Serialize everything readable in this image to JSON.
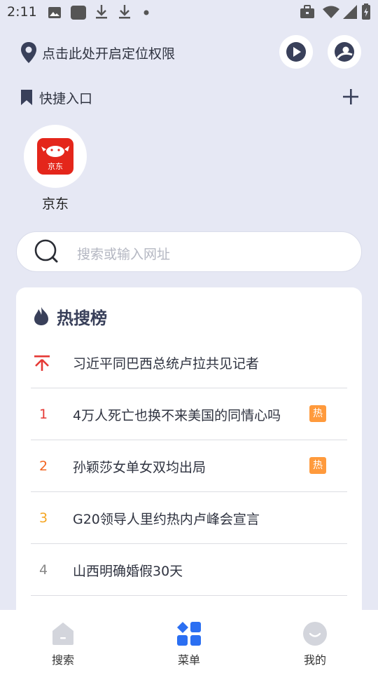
{
  "status_bar": {
    "time": "2:11",
    "icons": [
      "image-icon",
      "square-icon",
      "download-icon",
      "download-icon",
      "dot-icon",
      "briefcase-icon",
      "wifi-icon",
      "signal-icon",
      "battery-icon"
    ]
  },
  "location": {
    "text": "点击此处开启定位权限",
    "icon": "location-pin-icon"
  },
  "header_buttons": {
    "play": "play-icon",
    "user": "user-icon"
  },
  "quick_entry": {
    "title": "快捷入口",
    "icon": "bookmark-icon",
    "add_icon": "plus-icon",
    "items": [
      {
        "label": "京东",
        "logo_text": "京东",
        "icon": "jd-logo-icon",
        "color": "#e4261b"
      }
    ]
  },
  "search": {
    "placeholder": "搜索或输入网址",
    "icon": "search-icon"
  },
  "hot_list": {
    "title": "热搜榜",
    "icon": "flame-icon",
    "items": [
      {
        "rank": "",
        "rank_icon": "pin-top-icon",
        "text": "习近平同巴西总统卢拉共见记者",
        "badge": "",
        "rank_color": "#e53935"
      },
      {
        "rank": "1",
        "text": "4万人死亡也换不来美国的同情心吗",
        "badge": "热",
        "rank_color": "#e53935"
      },
      {
        "rank": "2",
        "text": "孙颖莎女单女双均出局",
        "badge": "热",
        "rank_color": "#f26522"
      },
      {
        "rank": "3",
        "text": "G20领导人里约热内卢峰会宣言",
        "badge": "",
        "rank_color": "#f5a623"
      },
      {
        "rank": "4",
        "text": "山西明确婚假30天",
        "badge": "",
        "rank_color": "#888888"
      }
    ],
    "badge_color": "#ff9a3c"
  },
  "bottom_nav": {
    "items": [
      {
        "label": "搜索",
        "icon": "home-icon",
        "active": false
      },
      {
        "label": "菜单",
        "icon": "menu-grid-icon",
        "active": true
      },
      {
        "label": "我的",
        "icon": "profile-icon",
        "active": false
      }
    ],
    "active_color": "#2b6ff2",
    "inactive_color": "#d3d5dc"
  }
}
